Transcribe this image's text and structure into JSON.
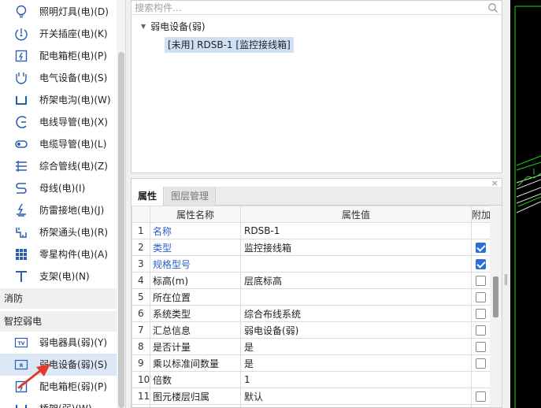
{
  "sidebar": {
    "items": [
      {
        "label": "照明灯具(电)(D)",
        "icon": "bulb-icon"
      },
      {
        "label": "开关插座(电)(K)",
        "icon": "switch-socket-icon"
      },
      {
        "label": "配电箱柜(电)(P)",
        "icon": "distribution-box-icon"
      },
      {
        "label": "电气设备(电)(S)",
        "icon": "electrical-equipment-icon"
      },
      {
        "label": "桥架电沟(电)(W)",
        "icon": "cable-tray-icon"
      },
      {
        "label": "电线导管(电)(X)",
        "icon": "wire-conduit-icon"
      },
      {
        "label": "电缆导管(电)(L)",
        "icon": "cable-conduit-icon"
      },
      {
        "label": "综合管线(电)(Z)",
        "icon": "integrated-pipeline-icon"
      },
      {
        "label": "母线(电)(I)",
        "icon": "busbar-icon"
      },
      {
        "label": "防雷接地(电)(J)",
        "icon": "lightning-grounding-icon"
      },
      {
        "label": "桥架通头(电)(R)",
        "icon": "tray-fitting-icon"
      },
      {
        "label": "零星构件(电)(A)",
        "icon": "misc-component-icon"
      },
      {
        "label": "支架(电)(N)",
        "icon": "bracket-icon"
      }
    ],
    "groups": [
      "消防",
      "智控弱电"
    ],
    "weak_items": [
      {
        "label": "弱电器具(弱)(Y)",
        "icon": "tv-device-icon",
        "icon_text": "TV"
      },
      {
        "label": "弱电设备(弱)(S)",
        "icon": "weak-equipment-icon",
        "icon_text": "R"
      },
      {
        "label": "配电箱柜(弱)(P)",
        "icon": "weak-distribution-box-icon"
      },
      {
        "label": "桥架(弱)(W)",
        "icon": "weak-tray-icon"
      }
    ]
  },
  "tree": {
    "search_placeholder": "搜索构件...",
    "root_label": "弱电设备(弱)",
    "child_label": "[未用] RDSB-1 [监控接线箱]"
  },
  "props": {
    "tabs": [
      "属性",
      "图层管理"
    ],
    "close_glyph": "×",
    "headers": {
      "name": "属性名称",
      "value": "属性值",
      "attach": "附加"
    },
    "rows": [
      {
        "idx": "1",
        "name": "名称",
        "value": "RDSB-1",
        "link": true,
        "checkbox": "none"
      },
      {
        "idx": "2",
        "name": "类型",
        "value": "监控接线箱",
        "link": true,
        "checkbox": "checked"
      },
      {
        "idx": "3",
        "name": "规格型号",
        "value": "",
        "link": true,
        "checkbox": "checked"
      },
      {
        "idx": "4",
        "name": "标高(m)",
        "value": "层底标高",
        "link": false,
        "checkbox": "unchecked"
      },
      {
        "idx": "5",
        "name": "所在位置",
        "value": "",
        "link": false,
        "checkbox": "unchecked"
      },
      {
        "idx": "6",
        "name": "系统类型",
        "value": "综合布线系统",
        "link": false,
        "checkbox": "unchecked"
      },
      {
        "idx": "7",
        "name": "汇总信息",
        "value": "弱电设备(弱)",
        "link": false,
        "checkbox": "unchecked"
      },
      {
        "idx": "8",
        "name": "是否计量",
        "value": "是",
        "link": false,
        "checkbox": "unchecked"
      },
      {
        "idx": "9",
        "name": "乘以标准间数量",
        "value": "是",
        "link": false,
        "checkbox": "unchecked"
      },
      {
        "idx": "10",
        "name": "倍数",
        "value": "1",
        "link": false,
        "checkbox": "none"
      },
      {
        "idx": "11",
        "name": "图元楼层归属",
        "value": "默认",
        "link": false,
        "checkbox": "unchecked"
      },
      {
        "idx": "",
        "name": "",
        "value": "",
        "link": false,
        "checkbox": "unchecked"
      }
    ]
  },
  "colors": {
    "link": "#2a62c9",
    "selection": "#cfe0f5",
    "checkbox_checked": "#2a6fd6",
    "canvas_bg": "#000000",
    "canvas_line": "#19d219",
    "arrow": "#e23a2b"
  }
}
